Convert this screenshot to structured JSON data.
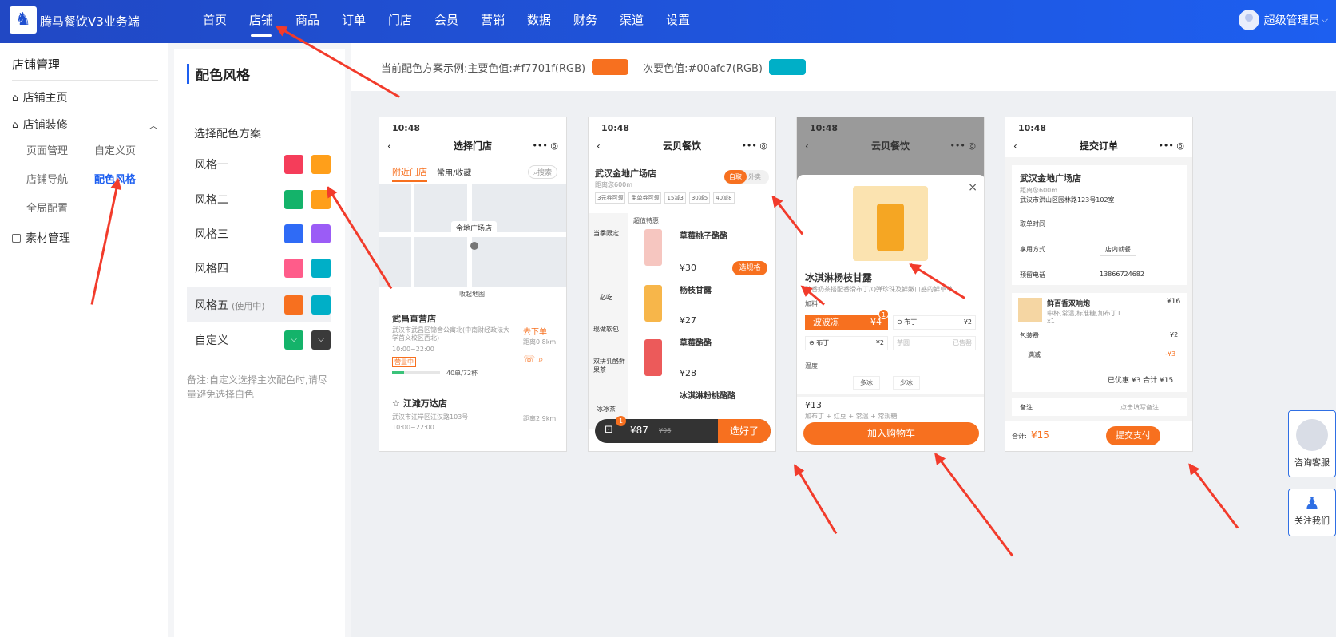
{
  "app": {
    "brand": "腾马餐饮V3业务端",
    "logo_glyph": "♞"
  },
  "nav": [
    "首页",
    "店铺",
    "商品",
    "订单",
    "门店",
    "会员",
    "营销",
    "数据",
    "财务",
    "渠道",
    "设置"
  ],
  "user": {
    "name": "超级管理员",
    "caret": "⌵"
  },
  "sidebar": {
    "title": "店铺管理",
    "home": "店铺主页",
    "decoration": "店铺装修",
    "sub": [
      "页面管理",
      "自定义页",
      "店铺导航",
      "配色风格",
      "全局配置"
    ],
    "material": "素材管理"
  },
  "panel": {
    "title": "配色风格",
    "choose_label": "选择配色方案",
    "styles": [
      {
        "name": "风格一",
        "tag": "",
        "primary": "#f53d5a",
        "secondary": "#ff9f1a"
      },
      {
        "name": "风格二",
        "tag": "",
        "primary": "#14b36a",
        "secondary": "#ff9f1a"
      },
      {
        "name": "风格三",
        "tag": "",
        "primary": "#2f6bf6",
        "secondary": "#9b5cf6"
      },
      {
        "name": "风格四",
        "tag": "",
        "primary": "#ff5c8a",
        "secondary": "#00afc7"
      },
      {
        "name": "风格五",
        "tag": "(使用中)",
        "primary": "#f7701f",
        "secondary": "#00afc7"
      },
      {
        "name": "自定义",
        "tag": "",
        "primary": "#14b36a",
        "secondary": "#3a3a3a"
      }
    ],
    "note": "备注:自定义选择主次配色时,请尽量避免选择白色"
  },
  "current": {
    "primary_label": "当前配色方案示例:主要色值:#f7701f(RGB)",
    "secondary_label": "次要色值:#00afc7(RGB)",
    "primary": "#f7701f",
    "secondary": "#00afc7"
  },
  "phone1": {
    "time": "10:48",
    "title": "选择门店",
    "tab1": "附近门店",
    "tab2": "常用/收藏",
    "search": "搜索",
    "map_pin": "金地广场店",
    "collapse": "收起地图",
    "store1": {
      "name": "武昌直营店",
      "addr": "武汉市武昌区锦舍公寓北(中南财经政法大学首义校区西北)",
      "hours": "10:00~22:00",
      "status": "营业中",
      "cups": "40单/72杯",
      "go": "去下单",
      "dist": "距离0.8km"
    },
    "store2": {
      "name": "江滩万达店",
      "addr": "武汉市江岸区江汉路103号",
      "hours": "10:00~22:00",
      "dist": "距离2.9km"
    }
  },
  "phone2": {
    "time": "10:48",
    "title": "云贝餐饮",
    "store": "武汉金地广场店",
    "dist": "距离您600m",
    "coupons": [
      "3元券可领",
      "免单券可领",
      "15减3",
      "30减5",
      "40减8"
    ],
    "mode1": "自取",
    "mode2": "外卖",
    "cats": [
      "当季限定",
      "必吃",
      "现做软包",
      "双拼乳酪鲜果茶",
      "冰冰茶"
    ],
    "section": "超值特惠",
    "items": [
      {
        "name": "草莓桃子酪酪",
        "price": "¥30"
      },
      {
        "name": "杨枝甘露",
        "price": "¥27"
      },
      {
        "name": "草莓酪酪",
        "price": "¥28"
      },
      {
        "name": "冰淇淋粉桃酪酪",
        "price": ""
      }
    ],
    "spec": "选规格",
    "cart_count": "1",
    "cart_total": "¥87",
    "cart_old": "¥96",
    "checkout": "选好了"
  },
  "phone3": {
    "time": "10:48",
    "title": "云贝餐饮",
    "product": "冰淇淋杨枝甘露",
    "desc": "醇香奶茶搭配香滑布丁/Q弹珍珠及鲜嫩口感的鲜草草",
    "addon_label": "加料",
    "addons": [
      {
        "name": "波波冻",
        "price": "¥4"
      },
      {
        "name": "布丁",
        "price": "¥2"
      },
      {
        "name": "布丁",
        "price": "¥2"
      },
      {
        "name": "芋圆",
        "price": "已售罄"
      }
    ],
    "temp_label": "温度",
    "temps": [
      "多冰",
      "少冰"
    ],
    "price": "¥13",
    "sub": "加布丁 + 红豆 + 常温 + 常规糖",
    "add_cart": "加入购物车",
    "badge": "1"
  },
  "phone4": {
    "time": "10:48",
    "title": "提交订单",
    "store": "武汉金地广场店",
    "dist": "距离您600m",
    "addr": "武汉市洪山区园林路123号102室",
    "rows": [
      {
        "k": "取单时间",
        "v": ""
      },
      {
        "k": "享用方式",
        "v": "店内就餐"
      },
      {
        "k": "预留电话",
        "v": "13866724682"
      }
    ],
    "item": {
      "name": "鲜百香双响炮",
      "spec": "中杯,常温,标准糖,加布丁1",
      "qty": "x1",
      "price": "¥16"
    },
    "pack": {
      "k": "包装费",
      "v": "¥2"
    },
    "discount": {
      "k": "满减",
      "v": "-¥3"
    },
    "summary": "已优惠 ¥3 合计 ¥15",
    "remark": "备注",
    "remark_hint": "点击填写备注",
    "total_label": "合计:",
    "total": "¥15",
    "submit": "提交支付"
  },
  "float": {
    "service": "咨询客服",
    "follow": "关注我们"
  }
}
